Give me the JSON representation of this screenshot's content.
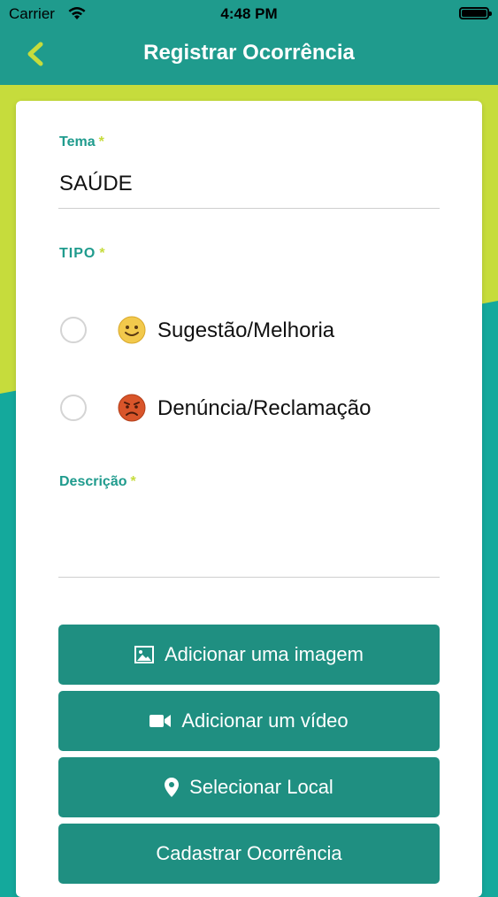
{
  "status_bar": {
    "carrier": "Carrier",
    "time": "4:48 PM"
  },
  "header": {
    "title": "Registrar Ocorrência",
    "back_icon": "chevron-left-icon"
  },
  "colors": {
    "nav": "#1f9b8d",
    "accent_green": "#c6dc3c",
    "teal": "#14a99c",
    "button": "#1f8f81",
    "label": "#1f9b8d"
  },
  "form": {
    "tema": {
      "label": "Tema",
      "required_mark": "*",
      "value": "SAÚDE"
    },
    "tipo": {
      "label": "TIPO",
      "required_mark": "*",
      "options": [
        {
          "label": "Sugestão/Melhoria",
          "icon": "smile-emoji-icon",
          "selected": false
        },
        {
          "label": "Denúncia/Reclamação",
          "icon": "angry-emoji-icon",
          "selected": false
        }
      ]
    },
    "descricao": {
      "label": "Descrição",
      "required_mark": "*",
      "value": ""
    }
  },
  "buttons": {
    "add_image": {
      "label": "Adicionar uma imagem",
      "icon": "image-icon"
    },
    "add_video": {
      "label": "Adicionar um vídeo",
      "icon": "video-camera-icon"
    },
    "select_location": {
      "label": "Selecionar Local",
      "icon": "map-pin-icon"
    },
    "submit": {
      "label": "Cadastrar Ocorrência"
    }
  }
}
